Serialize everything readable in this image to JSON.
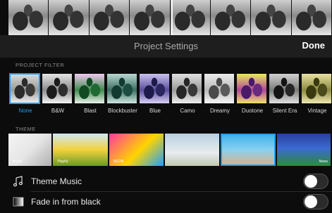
{
  "header": {
    "title": "Project Settings",
    "done_label": "Done"
  },
  "project_filter": {
    "section_label": "PROJECT FILTER",
    "selected": "None",
    "items": [
      {
        "label": "None",
        "sky": "#d8d8d8",
        "mid": "#9a9a9a",
        "gnd": "#ececec",
        "t1": "#2b2b2b",
        "t2": "#3a3a3a"
      },
      {
        "label": "B&W",
        "sky": "#e4e4e4",
        "mid": "#8c8c8c",
        "gnd": "#f5f5f5",
        "t1": "#1c1c1c",
        "t2": "#2e2e2e"
      },
      {
        "label": "Blast",
        "sky": "#f0c8f0",
        "mid": "#3f8a4e",
        "gnd": "#e8f0e8",
        "t1": "#0f4a22",
        "t2": "#1f6a32"
      },
      {
        "label": "Blockbuster",
        "sky": "#b8d8d2",
        "mid": "#3a6e60",
        "gnd": "#cfe6e0",
        "t1": "#123a30",
        "t2": "#1d4d40"
      },
      {
        "label": "Blue",
        "sky": "#c8c0ee",
        "mid": "#5a4e9a",
        "gnd": "#d8d0f4",
        "t1": "#1e1a4a",
        "t2": "#2c2660"
      },
      {
        "label": "Camo",
        "sky": "#dedede",
        "mid": "#9b9b9b",
        "gnd": "#f0f0f0",
        "t1": "#262626",
        "t2": "#383838"
      },
      {
        "label": "Dreamy",
        "sky": "#ececec",
        "mid": "#b8b8b8",
        "gnd": "#f8f8f8",
        "t1": "#4a4a4a",
        "t2": "#5a5a5a"
      },
      {
        "label": "Duotone",
        "sky": "#e8e860",
        "mid": "#b04898",
        "gnd": "#f0e070",
        "t1": "#4a1a6a",
        "t2": "#6a2a80"
      },
      {
        "label": "Silent Era",
        "sky": "#d0d0d0",
        "mid": "#7a7a7a",
        "gnd": "#e2e2e2",
        "t1": "#141414",
        "t2": "#262626"
      },
      {
        "label": "Vintage",
        "sky": "#e8e0a0",
        "mid": "#8a8a40",
        "gnd": "#f0e8b0",
        "t1": "#3a3a10",
        "t2": "#4a4a1a"
      }
    ]
  },
  "theme": {
    "section_label": "THEME",
    "items": [
      {
        "name": "bright",
        "tag": "Bright",
        "bg": "linear-gradient(135deg,#f4f4f4 0%,#e6e6e6 50%,#b0b0b0 100%)"
      },
      {
        "name": "playful",
        "tag": "Playful",
        "bg": "linear-gradient(180deg,#cfe8f8 0%,#f3d23a 50%,#6a9a2a 100%)"
      },
      {
        "name": "neon",
        "tag": "NEON",
        "bg": "linear-gradient(135deg,#ff3aa0 0%,#ffd400 55%,#1e9eff 100%)"
      },
      {
        "name": "travel",
        "tag": "",
        "bg": "linear-gradient(180deg,#b8d0e0 0%,#e8ecee 60%,#c0c8b0 100%)"
      },
      {
        "name": "simple",
        "tag": "",
        "bg": "linear-gradient(180deg,#3ab0e8 0%,#8ad0f0 50%,#e0b080 100%)"
      },
      {
        "name": "news",
        "tag": "News",
        "bg": "linear-gradient(180deg,#2a3ea0 0%,#3a6ad0 45%,#2e8a3a 100%)"
      }
    ]
  },
  "settings": {
    "theme_music_label": "Theme Music",
    "fade_from_black_label": "Fade in from black"
  }
}
